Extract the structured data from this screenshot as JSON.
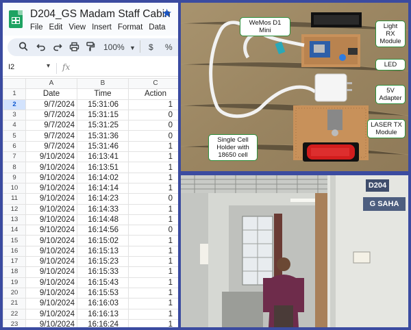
{
  "app": {
    "doc_title": "D204_GS Madam Staff Cabin",
    "menu": [
      "File",
      "Edit",
      "View",
      "Insert",
      "Format",
      "Data"
    ],
    "zoom": "100%",
    "currency_symbol": "$",
    "percent_symbol": "%",
    "name_box": "I2",
    "fx_label": "fx"
  },
  "sheet": {
    "columns": [
      "A",
      "B",
      "C"
    ],
    "headers": [
      "Date",
      "Time",
      "Action"
    ],
    "selected_row": "2",
    "rows": [
      {
        "n": "2",
        "date": "9/7/2024",
        "time": "15:31:06",
        "action": "1"
      },
      {
        "n": "3",
        "date": "9/7/2024",
        "time": "15:31:15",
        "action": "0"
      },
      {
        "n": "4",
        "date": "9/7/2024",
        "time": "15:31:25",
        "action": "0"
      },
      {
        "n": "5",
        "date": "9/7/2024",
        "time": "15:31:36",
        "action": "0"
      },
      {
        "n": "6",
        "date": "9/7/2024",
        "time": "15:31:46",
        "action": "1"
      },
      {
        "n": "7",
        "date": "9/10/2024",
        "time": "16:13:41",
        "action": "1"
      },
      {
        "n": "8",
        "date": "9/10/2024",
        "time": "16:13:51",
        "action": "1"
      },
      {
        "n": "9",
        "date": "9/10/2024",
        "time": "16:14:02",
        "action": "1"
      },
      {
        "n": "10",
        "date": "9/10/2024",
        "time": "16:14:14",
        "action": "1"
      },
      {
        "n": "11",
        "date": "9/10/2024",
        "time": "16:14:23",
        "action": "0"
      },
      {
        "n": "12",
        "date": "9/10/2024",
        "time": "16:14:33",
        "action": "1"
      },
      {
        "n": "13",
        "date": "9/10/2024",
        "time": "16:14:48",
        "action": "1"
      },
      {
        "n": "14",
        "date": "9/10/2024",
        "time": "16:14:56",
        "action": "0"
      },
      {
        "n": "15",
        "date": "9/10/2024",
        "time": "16:15:02",
        "action": "1"
      },
      {
        "n": "16",
        "date": "9/10/2024",
        "time": "16:15:13",
        "action": "1"
      },
      {
        "n": "17",
        "date": "9/10/2024",
        "time": "16:15:23",
        "action": "1"
      },
      {
        "n": "18",
        "date": "9/10/2024",
        "time": "16:15:33",
        "action": "1"
      },
      {
        "n": "19",
        "date": "9/10/2024",
        "time": "16:15:43",
        "action": "1"
      },
      {
        "n": "20",
        "date": "9/10/2024",
        "time": "16:15:53",
        "action": "1"
      },
      {
        "n": "21",
        "date": "9/10/2024",
        "time": "16:16:03",
        "action": "1"
      },
      {
        "n": "22",
        "date": "9/10/2024",
        "time": "16:16:13",
        "action": "1"
      },
      {
        "n": "23",
        "date": "9/10/2024",
        "time": "16:16:24",
        "action": "1"
      }
    ]
  },
  "hardware_labels": {
    "wemos": "WeMos D1 Mini",
    "light_rx": "Light RX Module",
    "led": "LED",
    "adapter": "5V Adapter",
    "laser_tx": "LASER TX Module",
    "cell_holder": "Single Cell Holder with 18650 cell"
  },
  "room": {
    "door_number": "D204",
    "name_plate": "G SAHA"
  },
  "colors": {
    "frame": "#3b4ba0",
    "sheets_green": "#1ea362",
    "label_border": "#2b8f3b",
    "star_blue": "#1a56c4"
  }
}
